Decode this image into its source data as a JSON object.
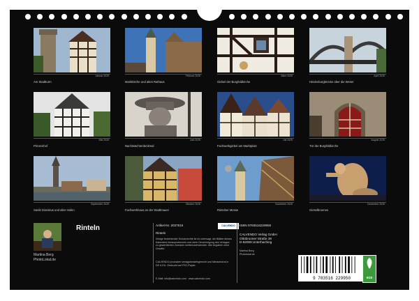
{
  "calendar": {
    "title": "Rinteln",
    "author": "Martina Berg",
    "author_site": "PhotoLokal.de"
  },
  "months": [
    {
      "month": "Januar 2025",
      "caption": "Am Stadtturm"
    },
    {
      "month": "Februar 2025",
      "caption": "Marktkirche und altes Rathaus"
    },
    {
      "month": "März 2025",
      "caption": "Giebel der Burgfeldkirche"
    },
    {
      "month": "April 2025",
      "caption": "Hindenburgbrücke über die Weser"
    },
    {
      "month": "Mai 2025",
      "caption": "Prinzenhof"
    },
    {
      "month": "Juni 2025",
      "caption": "Nachtwächterdenkmal"
    },
    {
      "month": "Juli 2025",
      "caption": "Fachwerkgiebel am Marktplatz"
    },
    {
      "month": "August 2025",
      "caption": "Tür der Burgfeldkirche"
    },
    {
      "month": "September 2025",
      "caption": "Sankt Dionisius und alter Hafen"
    },
    {
      "month": "Oktober 2025",
      "caption": "Fachwerkhaus an der Stadtmauer"
    },
    {
      "month": "November 2025",
      "caption": "Rintelner Messe"
    },
    {
      "month": "Dezember 2025",
      "caption": "Gieselbrunnen"
    }
  ],
  "info": {
    "article_label": "Artikel-Nr. 2037815",
    "isbn_label": "ISBN 9783516229950",
    "product_title": "Rinteln",
    "description": "Infolge bestehender Schutzrechte ist es untersagt, die Blätter dieses Kalenders herauszutrennen und ohne Genehmigung des Verlages zu gewerblichen Zwecken weiterzuverwenden. Alle Angaben ohne Gewähr.",
    "publisher_note": "CALVENDO produziert verlagsbedarfsgerecht und klimaneutral in DE & EU. Gedruckt auf FSC-Papier.",
    "contact": "E-Mail: info@calvendo.com · www.calvendo.com",
    "publisher_name": "CALVENDO Verlag GmbH",
    "publisher_street": "Ottobrunner Straße 39",
    "publisher_city": "D-82008 Unterhaching",
    "small_author": "Martina Berg",
    "small_site": "Photolokal.de",
    "barcode_digits": "9 783516 229950",
    "logo": "CALVENDO",
    "eco_label": "eco"
  }
}
